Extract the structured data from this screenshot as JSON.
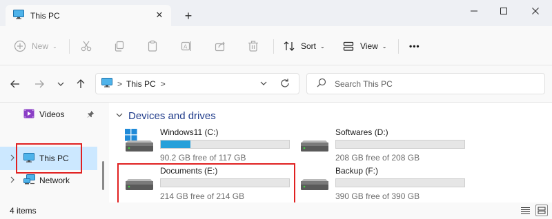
{
  "window": {
    "tab_title": "This PC",
    "tab_icon": "monitor-icon",
    "close_tab": "✕",
    "new_tab": "+"
  },
  "toolbar": {
    "new_label": "New",
    "sort_label": "Sort",
    "view_label": "View",
    "more_label": "•••",
    "chevron": "⌄"
  },
  "address": {
    "crumb": "This PC",
    "separator": ">",
    "search_placeholder": "Search This PC"
  },
  "navpane": {
    "items": [
      {
        "label": "Videos",
        "icon": "videos-icon",
        "pinned": true
      },
      {
        "label": "This PC",
        "icon": "monitor-icon",
        "selected": true
      },
      {
        "label": "Network",
        "icon": "network-icon"
      }
    ]
  },
  "content": {
    "group_title": "Devices and drives",
    "drives": [
      {
        "name": "Windows11 (C:)",
        "free_text": "90.2 GB free of 117 GB",
        "used_fraction": 0.23,
        "system": true
      },
      {
        "name": "Softwares (D:)",
        "free_text": "208 GB free of 208 GB",
        "used_fraction": 0.0
      },
      {
        "name": "Documents (E:)",
        "free_text": "214 GB free of 214 GB",
        "used_fraction": 0.0,
        "highlighted": true
      },
      {
        "name": "Backup (F:)",
        "free_text": "390 GB free of 390 GB",
        "used_fraction": 0.0
      }
    ]
  },
  "status": {
    "item_count": "4 items"
  },
  "colors": {
    "accent": "#26a0da",
    "highlight_box": "#e02020",
    "selection": "#cce8ff",
    "group_header": "#1f3b8a"
  }
}
